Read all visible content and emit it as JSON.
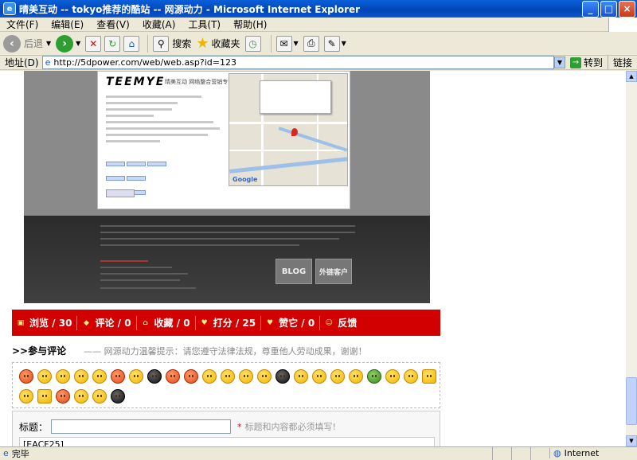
{
  "window": {
    "title": "晴美互动 -- tokyo推荐的酷站 -- 网源动力 - Microsoft Internet Explorer",
    "minimize": "_",
    "maximize": "□",
    "close": "×"
  },
  "menu": [
    "文件(F)",
    "编辑(E)",
    "查看(V)",
    "收藏(A)",
    "工具(T)",
    "帮助(H)"
  ],
  "toolbar": {
    "back": "后退",
    "search": "搜索",
    "favorites": "收藏夹"
  },
  "address": {
    "label": "地址(D)",
    "url": "http://5dpower.com/web/web.asp?id=123",
    "go": "转到",
    "links": "链接"
  },
  "screenshot": {
    "logo": "TEEMYE",
    "logo_sub": "晴美互动 网络整合营销专家",
    "blog_tile": "BLOG",
    "client_tile": "外链客户"
  },
  "actions": [
    {
      "icon": "comment-box-icon",
      "label": "浏览 / 30"
    },
    {
      "icon": "speech-bubble-icon",
      "label": "评论 / 0"
    },
    {
      "icon": "house-icon",
      "label": "收藏 / 0"
    },
    {
      "icon": "heart-icon",
      "label": "打分 / 25"
    },
    {
      "icon": "heart-icon",
      "label": "赞它 / 0"
    },
    {
      "icon": "smiley-icon",
      "label": "反馈"
    }
  ],
  "comments": {
    "heading": ">>参与评论",
    "tip": "—— 网源动力温馨提示：请您遵守法律法规，尊重他人劳动成果，谢谢！"
  },
  "form": {
    "title_label": "标题：",
    "title_value": "",
    "required_mark": "*",
    "required_hint": "标题和内容都必须填写!",
    "content_value": "[EACF25]"
  },
  "status": {
    "text": "完毕",
    "zone": "Internet"
  }
}
